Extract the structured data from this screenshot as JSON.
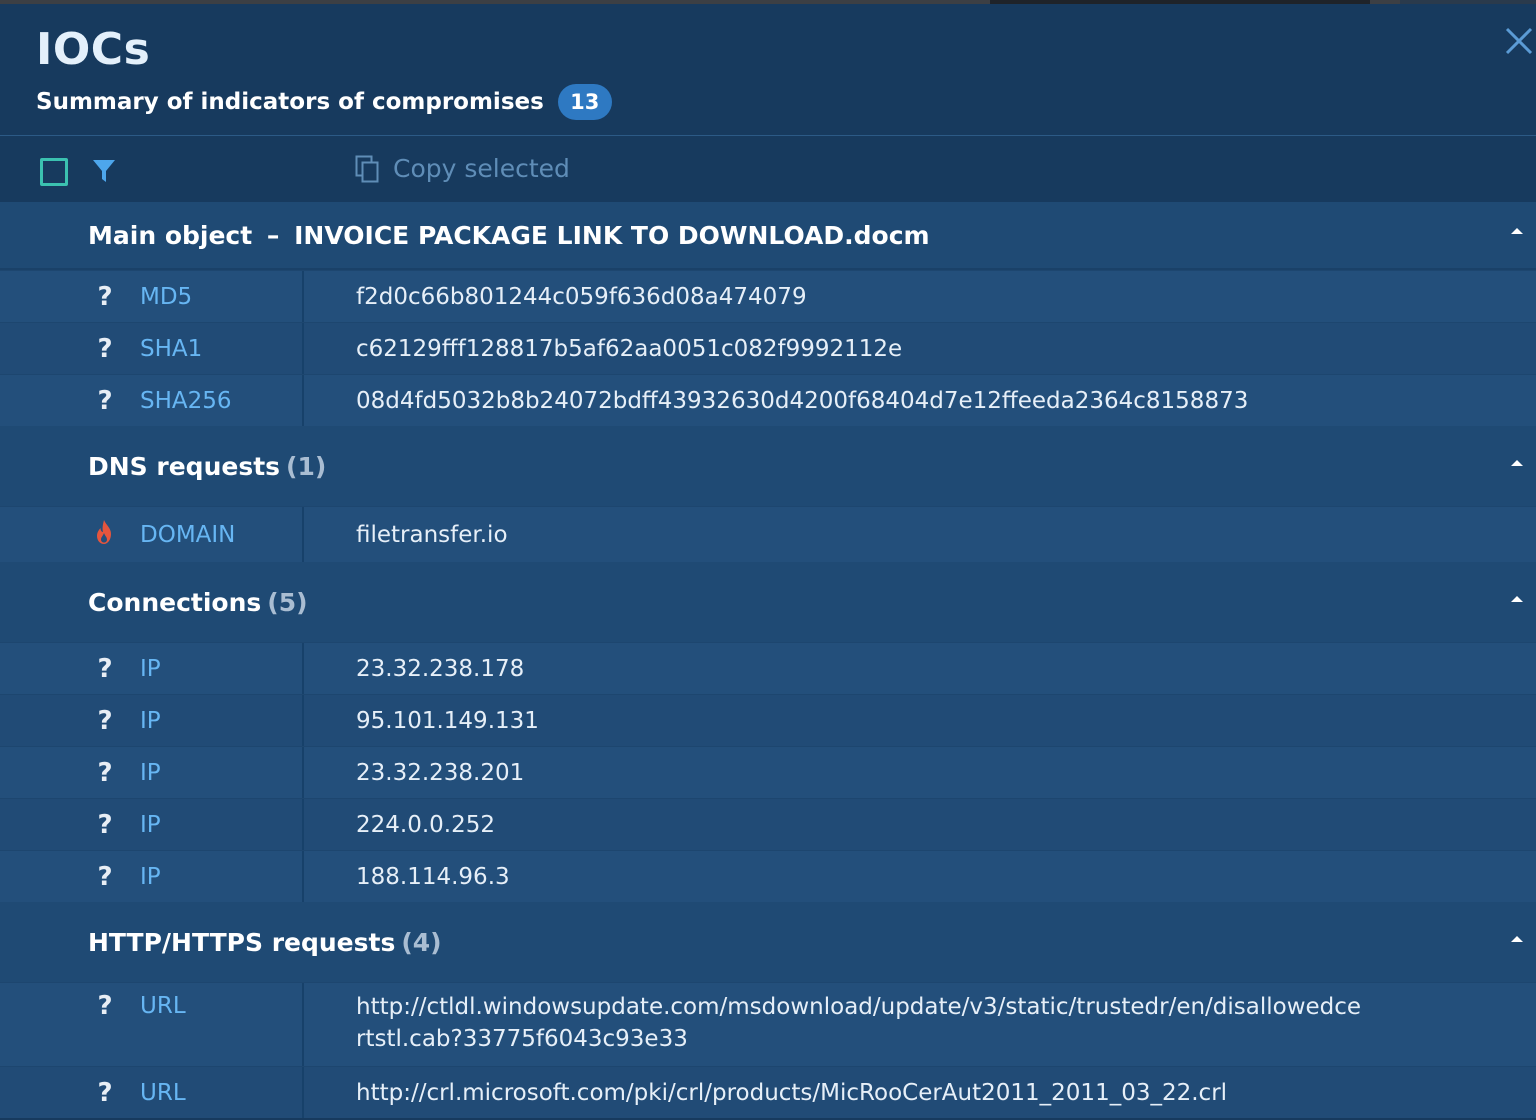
{
  "header": {
    "title": "IOCs",
    "subtitle": "Summary of indicators of compromises",
    "count": "13"
  },
  "toolbar": {
    "copy_label": "Copy selected"
  },
  "icons": {
    "close": "close-icon",
    "checkbox": "checkbox-icon",
    "filter": "filter-icon",
    "copy": "copy-icon",
    "unknown": "question-icon",
    "malicious": "fire-icon",
    "collapse": "chevron-up-icon"
  },
  "colors": {
    "accent": "#2e79c2",
    "type_label": "#67b6f3",
    "checkbox": "#3bc1b0",
    "malicious": "#e5553d"
  },
  "sections": {
    "main": {
      "title": "Main object",
      "dash": "–",
      "name": "INVOICE PACKAGE LINK TO DOWNLOAD.docm",
      "rows": [
        {
          "icon": "?",
          "type": "MD5",
          "value": "f2d0c66b801244c059f636d08a474079"
        },
        {
          "icon": "?",
          "type": "SHA1",
          "value": "c62129fff128817b5af62aa0051c082f9992112e"
        },
        {
          "icon": "?",
          "type": "SHA256",
          "value": "08d4fd5032b8b24072bdff43932630d4200f68404d7e12ffeeda2364c8158873"
        }
      ]
    },
    "dns": {
      "title": "DNS requests",
      "count": "(1)",
      "rows": [
        {
          "icon": "fire",
          "type": "DOMAIN",
          "value": "filetransfer.io"
        }
      ]
    },
    "connections": {
      "title": "Connections",
      "count": "(5)",
      "rows": [
        {
          "icon": "?",
          "type": "IP",
          "value": "23.32.238.178"
        },
        {
          "icon": "?",
          "type": "IP",
          "value": "95.101.149.131"
        },
        {
          "icon": "?",
          "type": "IP",
          "value": "23.32.238.201"
        },
        {
          "icon": "?",
          "type": "IP",
          "value": "224.0.0.252"
        },
        {
          "icon": "?",
          "type": "IP",
          "value": "188.114.96.3"
        }
      ]
    },
    "http": {
      "title": "HTTP/HTTPS requests",
      "count": "(4)",
      "rows": [
        {
          "icon": "?",
          "type": "URL",
          "value": "http://ctldl.windowsupdate.com/msdownload/update/v3/static/trustedr/en/disallowedcertstl.cab?33775f6043c93e33"
        },
        {
          "icon": "?",
          "type": "URL",
          "value": "http://crl.microsoft.com/pki/crl/products/MicRooCerAut2011_2011_03_22.crl"
        }
      ]
    }
  }
}
